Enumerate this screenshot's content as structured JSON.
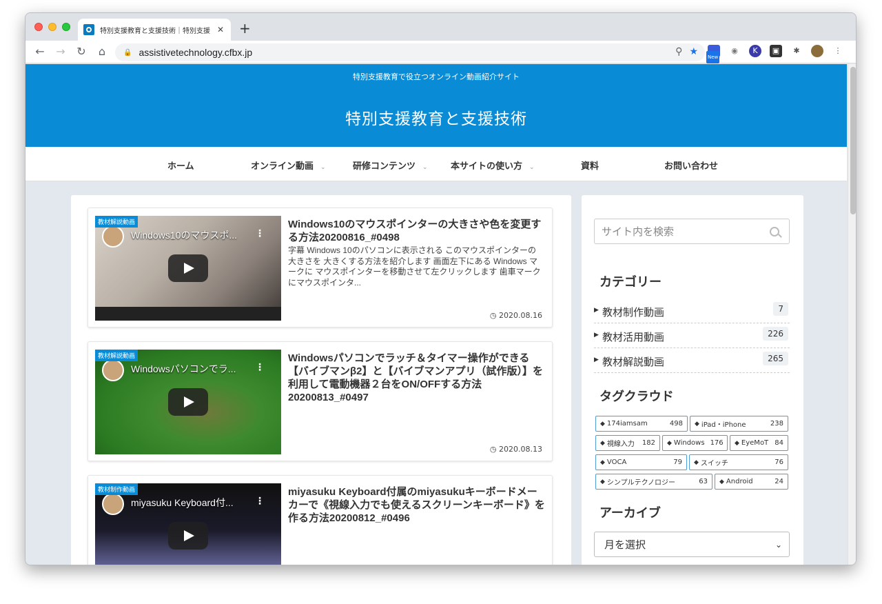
{
  "browser": {
    "tab_title": "特別支援教育と支援技術｜特別支援",
    "url": "assistivetechnology.cfbx.jp",
    "new_badge": "New"
  },
  "site": {
    "tagline": "特別支援教育で役立つオンライン動画紹介サイト",
    "name": "特別支援教育と支援技術"
  },
  "nav": [
    {
      "label": "ホーム",
      "dropdown": false
    },
    {
      "label": "オンライン動画",
      "dropdown": true
    },
    {
      "label": "研修コンテンツ",
      "dropdown": true
    },
    {
      "label": "本サイトの使い方",
      "dropdown": true
    },
    {
      "label": "資料",
      "dropdown": false
    },
    {
      "label": "お問い合わせ",
      "dropdown": false
    }
  ],
  "posts": [
    {
      "category": "教材解説動画",
      "video_title": "Windows10のマウスポ...",
      "title": "Windows10のマウスポインターの大きさや色を変更する方法20200816_#0498",
      "excerpt": "字幕 Windows 10のパソコンに表示される このマウスポインターの大きさを 大きくする方法を紹介します 画面左下にある Windows マークに マウスポインターを移動させて左クリックします 歯車マークにマウスポインタ...",
      "date": "2020.08.16"
    },
    {
      "category": "教材解説動画",
      "video_title": "Windowsパソコンでラ...",
      "title": "Windowsパソコンでラッチ＆タイマー操作ができる【バイブマンβ2】と【バイブマンアプリ（試作版）】を利用して電動機器２台をON/OFFする方法20200813_#0497",
      "excerpt": "",
      "date": "2020.08.13"
    },
    {
      "category": "教材制作動画",
      "video_title": "miyasuku Keyboard付...",
      "title": "miyasuku Keyboard付属のmiyasukuキーボードメーカーで《視線入力でも使えるスクリーンキーボード》を作る方法20200812_#0496",
      "excerpt": "",
      "date": ""
    }
  ],
  "sidebar": {
    "search_placeholder": "サイト内を検索",
    "categories_title": "カテゴリー",
    "categories": [
      {
        "name": "教材制作動画",
        "count": "7"
      },
      {
        "name": "教材活用動画",
        "count": "226"
      },
      {
        "name": "教材解説動画",
        "count": "265"
      }
    ],
    "tagcloud_title": "タグクラウド",
    "tags": [
      {
        "name": "174iamsam",
        "count": "498"
      },
      {
        "name": "iPad・iPhone",
        "count": "238"
      },
      {
        "name": "視線入力",
        "count": "182"
      },
      {
        "name": "Windows",
        "count": "176"
      },
      {
        "name": "EyeMoT",
        "count": "84"
      },
      {
        "name": "VOCA",
        "count": "79"
      },
      {
        "name": "スイッチ",
        "count": "76"
      },
      {
        "name": "シンプルテクノロジー",
        "count": "63"
      },
      {
        "name": "Android",
        "count": "24"
      }
    ],
    "archive_title": "アーカイブ",
    "archive_select": "月を選択"
  }
}
